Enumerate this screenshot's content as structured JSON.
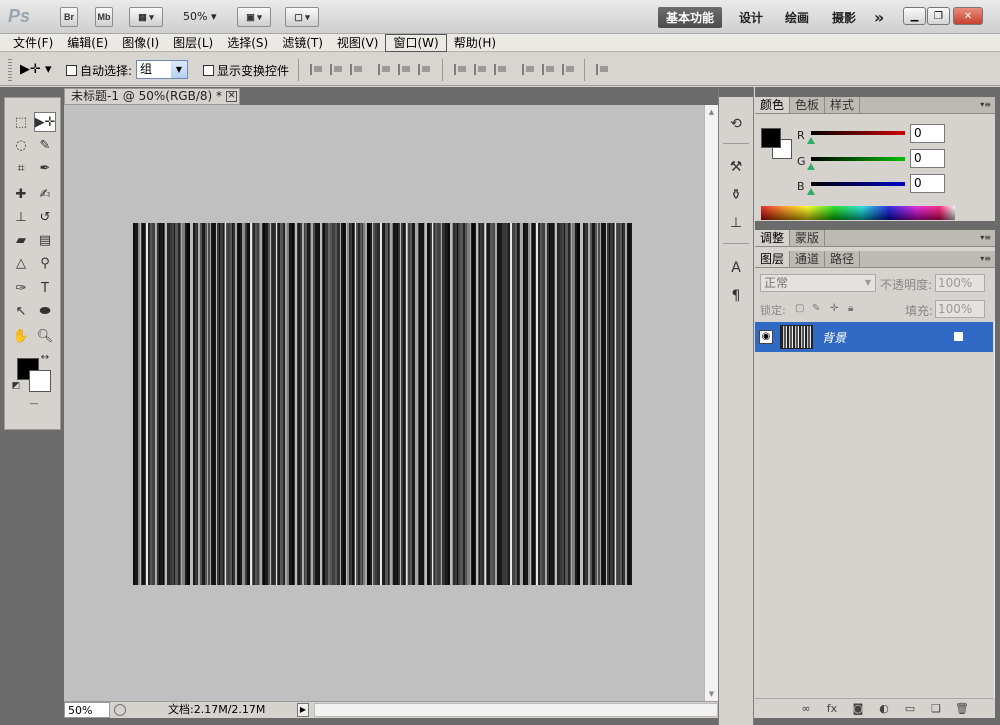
{
  "app": {
    "logo": "Ps",
    "launch_buttons": [
      "Br",
      "Mb"
    ],
    "zoom_dropdown": "50%",
    "workspaces": [
      {
        "label": "基本功能",
        "active": true
      },
      {
        "label": "设计",
        "active": false
      },
      {
        "label": "绘画",
        "active": false
      },
      {
        "label": "摄影",
        "active": false
      }
    ],
    "more_workspaces": "»"
  },
  "menu": [
    "文件(F)",
    "编辑(E)",
    "图像(I)",
    "图层(L)",
    "选择(S)",
    "滤镜(T)",
    "视图(V)",
    "窗口(W)",
    "帮助(H)"
  ],
  "options": {
    "auto_select_label": "自动选择:",
    "auto_select_value": "组",
    "show_transform_label": "显示变换控件"
  },
  "document": {
    "tab_title": "未标题-1 @ 50%(RGB/8) *",
    "status_zoom": "50%",
    "status_doc": "文档:2.17M/2.17M"
  },
  "color_panel": {
    "tabs": [
      "颜色",
      "色板",
      "样式"
    ],
    "channels": [
      {
        "label": "R",
        "value": "0",
        "color": "#d00000"
      },
      {
        "label": "G",
        "value": "0",
        "color": "#00c000"
      },
      {
        "label": "B",
        "value": "0",
        "color": "#0000c8"
      }
    ]
  },
  "adjust_panel": {
    "tabs": [
      "调整",
      "蒙版"
    ]
  },
  "layers_panel": {
    "tabs": [
      "图层",
      "通道",
      "路径"
    ],
    "blend_mode": "正常",
    "opacity_label": "不透明度:",
    "opacity_value": "100%",
    "lock_label": "锁定:",
    "fill_label": "填充:",
    "fill_value": "100%",
    "layers": [
      {
        "name": "背景",
        "visible": true,
        "locked": true,
        "selected": true
      }
    ]
  },
  "colors": {
    "accent_selection": "#316ac5",
    "panel_bg": "#d6d3ce",
    "pasteboard": "#c0c0c0",
    "frame_dark": "#6b6b6b"
  }
}
